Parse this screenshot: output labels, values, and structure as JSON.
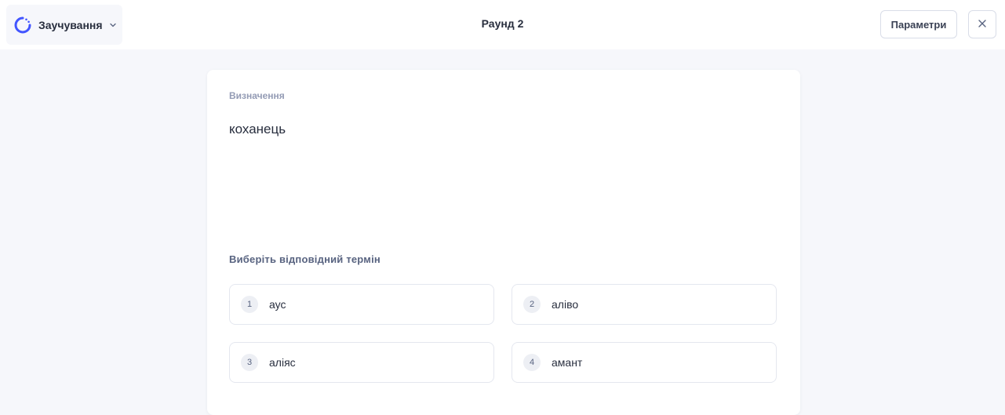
{
  "header": {
    "mode_label": "Заучування",
    "round_title": "Раунд 2",
    "options_label": "Параметри"
  },
  "card": {
    "definition_label": "Визначення",
    "definition_text": "коханець",
    "prompt": "Виберіть відповідний термін",
    "answers": [
      {
        "number": "1",
        "text": "аус"
      },
      {
        "number": "2",
        "text": "аліво"
      },
      {
        "number": "3",
        "text": "аліяс"
      },
      {
        "number": "4",
        "text": "амант"
      }
    ]
  },
  "icons": {
    "mode": "learn-mode-icon",
    "chevron": "chevron-down-icon",
    "close": "close-icon"
  },
  "colors": {
    "accent": "#4255ff",
    "background": "#f6f7fb",
    "text": "#282e3e",
    "muted": "#939bb4"
  }
}
